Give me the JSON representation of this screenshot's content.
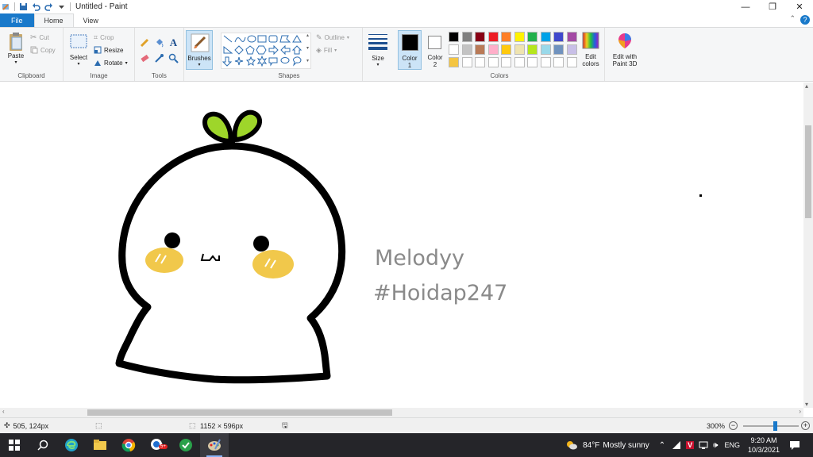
{
  "window": {
    "title": "Untitled - Paint",
    "minimize": "—",
    "restore": "❐",
    "close": "✕"
  },
  "tabs": {
    "file": "File",
    "home": "Home",
    "view": "View",
    "help": "?",
    "collapse": "⌃"
  },
  "ribbon": {
    "clipboard": {
      "label": "Clipboard",
      "paste": "Paste",
      "cut": "Cut",
      "copy": "Copy"
    },
    "image": {
      "label": "Image",
      "select": "Select",
      "crop": "Crop",
      "resize": "Resize",
      "rotate": "Rotate"
    },
    "tools": {
      "label": "Tools"
    },
    "brushes": {
      "label": "Brushes"
    },
    "shapes": {
      "label": "Shapes",
      "outline": "Outline",
      "fill": "Fill"
    },
    "size": {
      "label": "Size"
    },
    "colors": {
      "label": "Colors",
      "color1_label": "Color",
      "color1_num": "1",
      "color2_label": "Color",
      "color2_num": "2",
      "color1": "#000000",
      "color2": "#ffffff",
      "edit_label": "Edit",
      "edit_label2": "colors",
      "paint3d_label": "Edit with",
      "paint3d_label2": "Paint 3D",
      "palette_row1": [
        "#000000",
        "#7f7f7f",
        "#880015",
        "#ed1c24",
        "#ff7f27",
        "#fff200",
        "#22b14c",
        "#00a2e8",
        "#3f48cc",
        "#a349a4"
      ],
      "palette_row2": [
        "#ffffff",
        "#c3c3c3",
        "#b97a57",
        "#ffaec9",
        "#ffc90e",
        "#efe4b0",
        "#b5e61d",
        "#99d9ea",
        "#7092be",
        "#c8bfe7"
      ],
      "palette_row3": [
        "#f4c542",
        "#ffffff",
        "#ffffff",
        "#ffffff",
        "#ffffff",
        "#ffffff",
        "#ffffff",
        "#ffffff",
        "#ffffff",
        "#ffffff"
      ]
    }
  },
  "drawing": {
    "text1": "Melodyy",
    "text2": "#Hoidap247",
    "colors": {
      "outline": "#000000",
      "leaf": "#9ed62a",
      "cheek": "#f1c84b"
    }
  },
  "status": {
    "cursor": "505, 124px",
    "size": "1152 × 596px",
    "zoom": "300%"
  },
  "taskbar": {
    "weather_temp": "84°F",
    "weather_desc": "Mostly sunny",
    "lang": "ENG",
    "time": "9:20 AM",
    "date": "10/3/2021",
    "badge": "5+"
  }
}
